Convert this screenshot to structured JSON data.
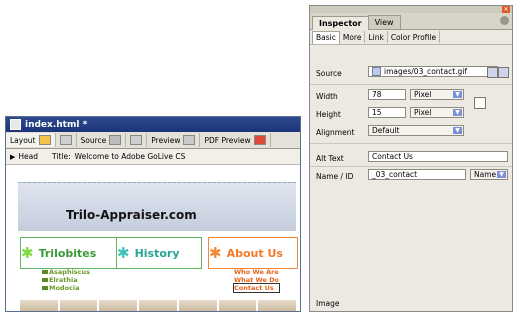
{
  "doc_window": {
    "title": "index.html *",
    "modes": [
      {
        "label": "Layout",
        "icon": "layout-icon"
      },
      {
        "label": "Source",
        "icon": "source-icon"
      },
      {
        "label": "Preview",
        "icon": "preview-icon"
      },
      {
        "label": "PDF Preview",
        "icon": "pdf-icon"
      }
    ],
    "head_label": "Head",
    "title_label": "Title:",
    "title_value": "Welcome to Adobe GoLive CS"
  },
  "page": {
    "banner_text": "Trilo-Appraiser.com",
    "nav": [
      {
        "label": "Trilobites"
      },
      {
        "label": "History"
      },
      {
        "label": "About Us"
      }
    ],
    "trilobites_sub": [
      "Asaphiscus",
      "Elrathia",
      "Modocia"
    ],
    "about_sub": [
      "Who We Are",
      "What We Do",
      "Contact Us"
    ]
  },
  "inspector": {
    "tabs": [
      "Inspector",
      "View"
    ],
    "subtabs": [
      "Basic",
      "More",
      "Link",
      "Color Profile"
    ],
    "source_label": "Source",
    "source_value": "images/03_contact.gif",
    "width_label": "Width",
    "width_value": "78",
    "width_unit": "Pixel",
    "height_label": "Height",
    "height_value": "15",
    "height_unit": "Pixel",
    "alignment_label": "Alignment",
    "alignment_value": "Default",
    "alt_label": "Alt Text",
    "alt_value": "Contact Us",
    "name_label": "Name / ID",
    "name_value": "_03_contact",
    "name_mode": "Name I",
    "status": "Image"
  }
}
